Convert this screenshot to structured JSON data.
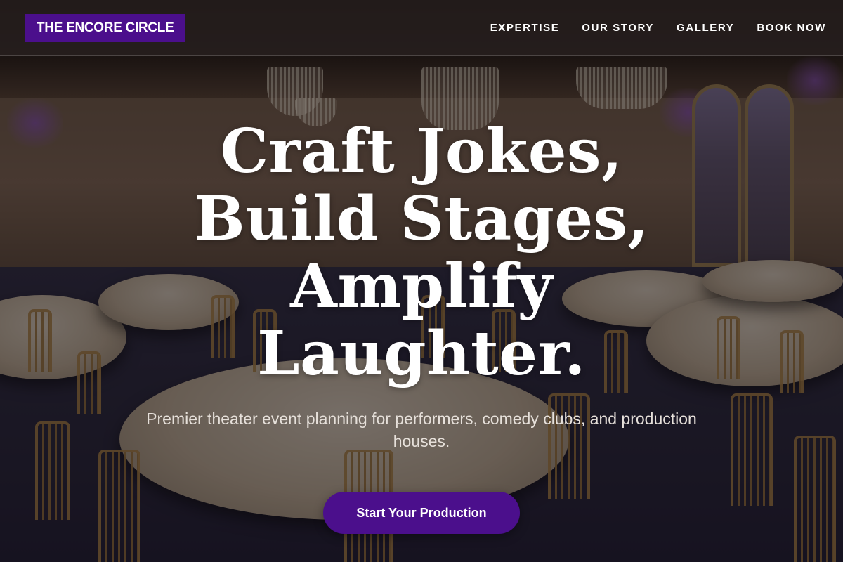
{
  "header": {
    "logo_text": "THE ENCORE CIRCLE",
    "nav": [
      {
        "label": "EXPERTISE"
      },
      {
        "label": "OUR STORY"
      },
      {
        "label": "GALLERY"
      },
      {
        "label": "BOOK NOW"
      }
    ]
  },
  "hero": {
    "title": "Craft Jokes, Build Stages, Amplify Laughter.",
    "subtitle": "Premier theater event planning for performers, comedy clubs, and production houses.",
    "cta_label": "Start Your Production",
    "background_image": "ballroom with round tables, gold chiavari chairs and crystal chandeliers"
  },
  "colors": {
    "brand_purple": "#4b0f8c",
    "header_bg": "#221c1c",
    "text_white": "#ffffff"
  }
}
